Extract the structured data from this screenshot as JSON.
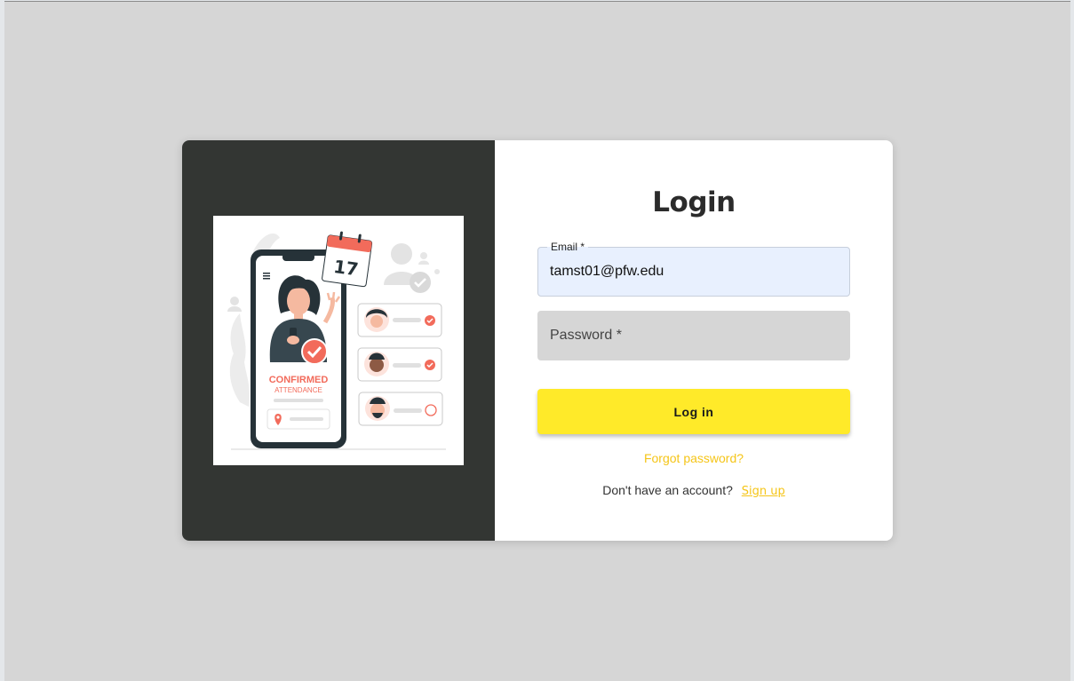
{
  "login": {
    "title": "Login",
    "email_label": "Email *",
    "email_value": "tamst01@pfw.edu",
    "password_placeholder": "Password *",
    "submit_label": "Log in",
    "forgot_password": "Forgot password?",
    "no_account_text": "Don't have an account?",
    "signup_link": "Sign up"
  },
  "illustration": {
    "calendar_day": "17",
    "headline": "CONFIRMED",
    "subheadline": "ATTENDANCE"
  },
  "colors": {
    "accent": "#ffea29",
    "link": "#f5c518",
    "panel": "#333633",
    "illustration_accent": "#f26b5b"
  }
}
